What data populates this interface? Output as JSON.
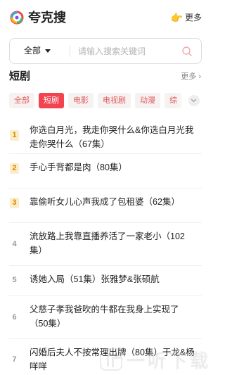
{
  "app": {
    "title": "夸克搜",
    "more_label": "更多"
  },
  "search": {
    "scope_label": "全部",
    "placeholder": "请输入搜索关键词",
    "value": ""
  },
  "section": {
    "title": "短剧",
    "more_label": "更多 ›"
  },
  "tabs": [
    {
      "label": "全部",
      "active": false
    },
    {
      "label": "短剧",
      "active": true
    },
    {
      "label": "电影",
      "active": false
    },
    {
      "label": "电视剧",
      "active": false
    },
    {
      "label": "动漫",
      "active": false
    },
    {
      "label": "综",
      "active": false
    }
  ],
  "list": [
    {
      "rank": "1",
      "title": "你选白月光，我走你哭什么&你选白月光我走你哭什么（67集）"
    },
    {
      "rank": "2",
      "title": "手心手背都是肉（80集）"
    },
    {
      "rank": "3",
      "title": "靠偷听女儿心声我成了包租婆（62集）"
    },
    {
      "rank": "4",
      "title": "流放路上我靠直播养活了一家老小（102集）"
    },
    {
      "rank": "5",
      "title": "诱她入局（51集）张雅梦&张硕航"
    },
    {
      "rank": "6",
      "title": "父慈子孝我爸吹的牛都在我身上实现了（50集）"
    },
    {
      "rank": "7",
      "title": "闪婚后夫人不按常理出牌（80集）于龙&杨咩咩"
    }
  ],
  "watermark": {
    "text": "一听下载"
  },
  "colors": {
    "accent": "#f2434f",
    "rank_top_bg": "#fdecc8",
    "rank_top_fg": "#d58a00"
  },
  "icons": {
    "logo": "colorful-ring-logo",
    "more": "pointing-hand-icon",
    "search": "search-icon",
    "expand": "chevron-down-icon"
  }
}
